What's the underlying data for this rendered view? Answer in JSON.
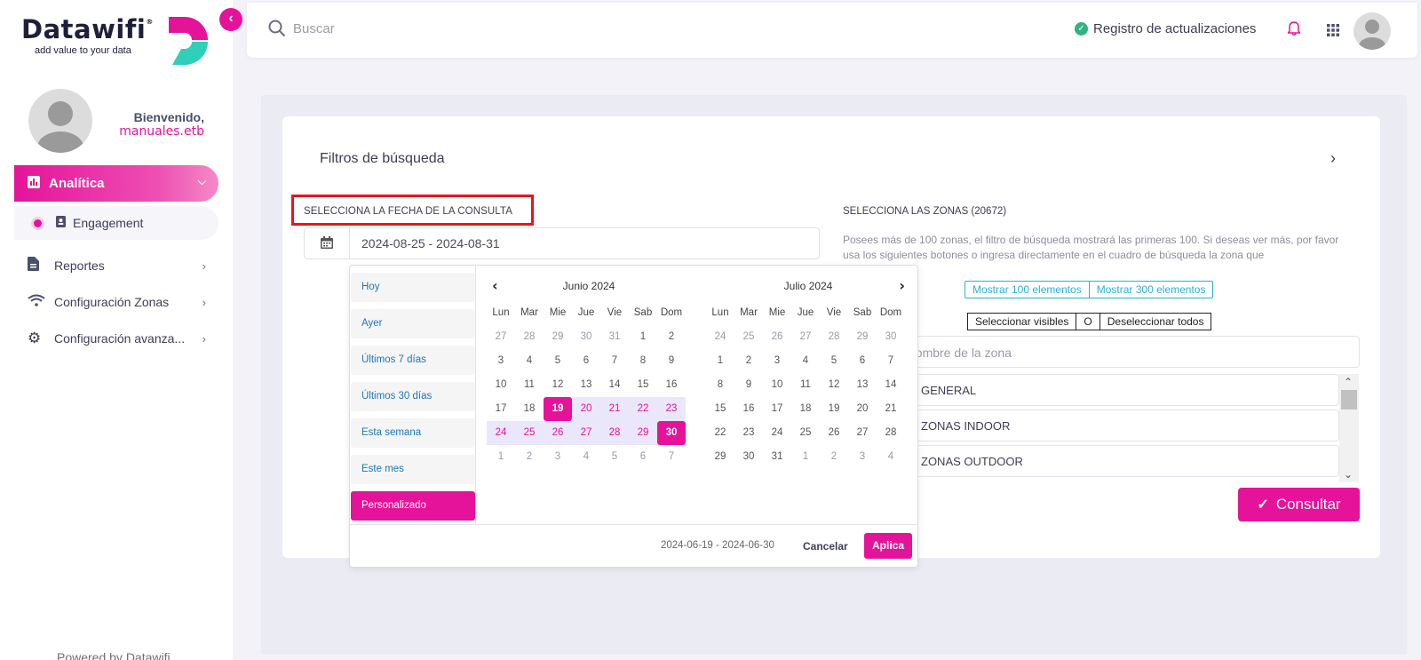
{
  "sidebar": {
    "logo_word": "Datawifi",
    "logo_reg": "®",
    "logo_tagline": "add value to your data",
    "welcome": "Bienvenido,",
    "username": "manuales.etb",
    "items": [
      {
        "label": "Analítica",
        "icon": "chart-icon",
        "active": true
      },
      {
        "label": "Engagement",
        "icon": "contact-book-icon",
        "sub": true
      },
      {
        "label": "Reportes",
        "icon": "document-icon"
      },
      {
        "label": "Configuración Zonas",
        "icon": "wifi-icon"
      },
      {
        "label": "Configuración avanza...",
        "icon": "gear-icon"
      }
    ],
    "powered": "Powered by Datawifi"
  },
  "header": {
    "search_placeholder": "Buscar",
    "updates_label": "Registro de actualizaciones"
  },
  "main": {
    "filters_title": "Filtros de búsqueda",
    "date_label": "SELECCIONA LA FECHA DE LA CONSULTA",
    "date_value": "2024-08-25 - 2024-08-31",
    "zones_label": "SELECCIONA LAS ZONAS (20672)",
    "zones_help": "Posees más de 100 zonas, el filtro de búsqueda mostrará las primeras 100. Si deseas ver más, por favor usa los siguientes botones o ingresa directamente en el cuadro de búsqueda la zona que",
    "show_100": "Mostrar 100 elementos",
    "show_300": "Mostrar 300 elementos",
    "select_visible": "Seleccionar visibles",
    "or_label": "O",
    "deselect_all": "Deseleccionar todos",
    "zone_search_placeholder": "hombre de la zona",
    "zones": [
      "GENERAL",
      "ZONAS INDOOR",
      "ZONAS OUTDOOR"
    ],
    "consultar": "Consultar"
  },
  "picker": {
    "ranges": [
      "Hoy",
      "Ayer",
      "Últimos 7 días",
      "Últimos 30 días",
      "Esta semana",
      "Este mes",
      "Personalizado"
    ],
    "active_range": "Personalizado",
    "day_headers": [
      "Lun",
      "Mar",
      "Mie",
      "Jue",
      "Vie",
      "Sab",
      "Dom"
    ],
    "months": [
      {
        "title": "Junio 2024",
        "days": [
          [
            "27",
            "28",
            "29",
            "30",
            "31",
            "1",
            "2"
          ],
          [
            "3",
            "4",
            "5",
            "6",
            "7",
            "8",
            "9"
          ],
          [
            "10",
            "11",
            "12",
            "13",
            "14",
            "15",
            "16"
          ],
          [
            "17",
            "18",
            "19",
            "20",
            "21",
            "22",
            "23"
          ],
          [
            "24",
            "25",
            "26",
            "27",
            "28",
            "29",
            "30"
          ],
          [
            "1",
            "2",
            "3",
            "4",
            "5",
            "6",
            "7"
          ]
        ],
        "off_rows": {
          "0": [
            0,
            1,
            2,
            3,
            4
          ],
          "5": [
            0,
            1,
            2,
            3,
            4,
            5,
            6
          ]
        },
        "in_range": {
          "3": [
            3,
            4,
            5,
            6
          ],
          "4": [
            0,
            1,
            2,
            3,
            4,
            5
          ]
        },
        "selected": {
          "3": [
            2
          ],
          "4": [
            6
          ]
        }
      },
      {
        "title": "Julio 2024",
        "days": [
          [
            "24",
            "25",
            "26",
            "27",
            "28",
            "29",
            "30"
          ],
          [
            "1",
            "2",
            "3",
            "4",
            "5",
            "6",
            "7"
          ],
          [
            "8",
            "9",
            "10",
            "11",
            "12",
            "13",
            "14"
          ],
          [
            "15",
            "16",
            "17",
            "18",
            "19",
            "20",
            "21"
          ],
          [
            "22",
            "23",
            "24",
            "25",
            "26",
            "27",
            "28"
          ],
          [
            "29",
            "30",
            "31",
            "1",
            "2",
            "3",
            "4"
          ]
        ],
        "off_rows": {
          "0": [
            0,
            1,
            2,
            3,
            4,
            5,
            6
          ],
          "5": [
            3,
            4,
            5,
            6
          ]
        },
        "in_range": {},
        "selected": {}
      }
    ],
    "selected_range": "2024-06-19 - 2024-06-30",
    "cancel": "Cancelar",
    "apply": "Aplica"
  },
  "colors": {
    "accent": "#e5139a",
    "highlight": "#e8141c",
    "range_bg": "#eae7fb",
    "link": "#1d76b8"
  }
}
